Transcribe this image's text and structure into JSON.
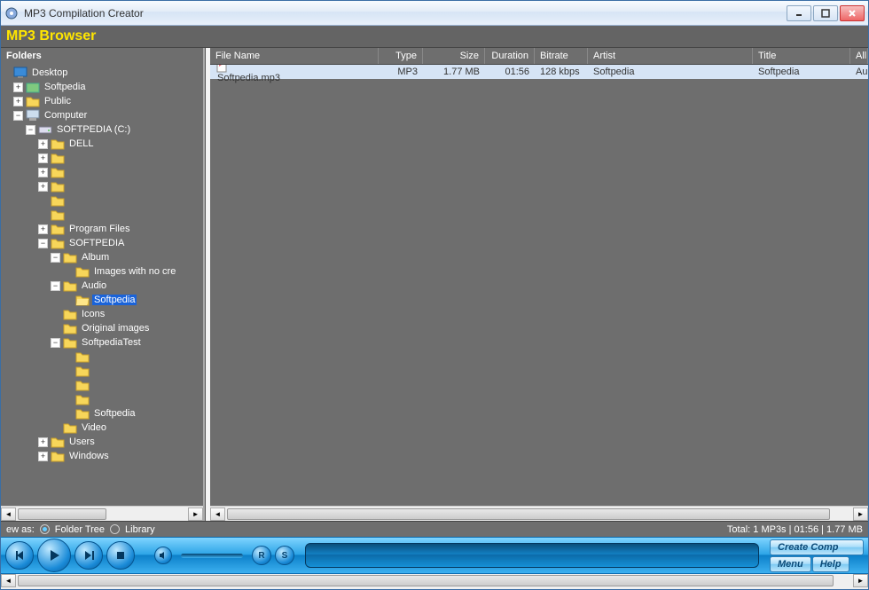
{
  "window": {
    "title": "MP3 Compilation Creator"
  },
  "browser_title": "MP3 Browser",
  "sidebar": {
    "header": "Folders",
    "tree": {
      "desktop": "Desktop",
      "softpedia1": "Softpedia",
      "public": "Public",
      "computer": "Computer",
      "drive": "SOFTPEDIA (C:)",
      "dell": "DELL",
      "program_files": "Program Files",
      "softpedia_folder": "SOFTPEDIA",
      "album": "Album",
      "images_no_cre": "Images with no cre",
      "audio": "Audio",
      "softpedia_sel": "Softpedia",
      "icons": "Icons",
      "original_images": "Original images",
      "softpedia_test": "SoftpediaTest",
      "softpedia2": "Softpedia",
      "video": "Video",
      "users": "Users",
      "windows": "Windows"
    }
  },
  "list": {
    "columns": {
      "name": "File Name",
      "type": "Type",
      "size": "Size",
      "duration": "Duration",
      "bitrate": "Bitrate",
      "artist": "Artist",
      "title": "Title",
      "all": "All"
    },
    "rows": [
      {
        "name": "Softpedia.mp3",
        "type": "MP3",
        "size": "1.77 MB",
        "duration": "01:56",
        "bitrate": "128 kbps",
        "artist": "Softpedia",
        "title": "Softpedia",
        "all": "Au"
      }
    ]
  },
  "status": {
    "view_as": "ew as:",
    "folder_tree": "Folder Tree",
    "library": "Library",
    "total": "Total: 1 MP3s | 01:56 | 1.77 MB"
  },
  "player": {
    "r": "R",
    "s": "S",
    "create_comp": "Create Comp",
    "menu": "Menu",
    "help": "Help"
  }
}
